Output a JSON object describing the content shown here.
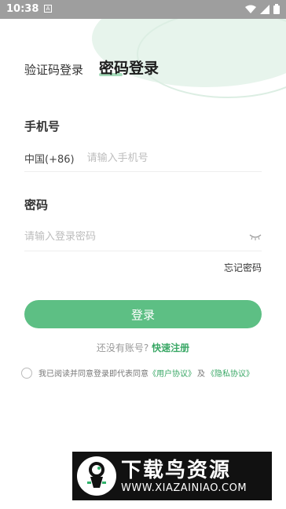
{
  "status_bar": {
    "time": "10:38",
    "notification_glyph": "A",
    "icons": [
      "wifi-icon",
      "signal-icon",
      "battery-icon"
    ]
  },
  "tabs": {
    "sms_login": "验证码登录",
    "password_login": "密码登录"
  },
  "phone": {
    "label": "手机号",
    "country_code": "中国(+86)",
    "placeholder": "请输入手机号",
    "value": ""
  },
  "password": {
    "label": "密码",
    "placeholder": "请输入登录密码",
    "value": "",
    "toggle_icon": "eye-closed-icon"
  },
  "forgot_password": "忘记密码",
  "login_button": "登录",
  "register": {
    "prompt": "还没有账号?",
    "link": "快速注册"
  },
  "agreement": {
    "prefix": "我已阅读并同意登录即代表同意",
    "user_agreement": "《用户协议》",
    "and": "及",
    "privacy_agreement": "《隐私协议》",
    "checked": false
  },
  "watermark": {
    "title": "下载鸟资源",
    "url": "WWW.XIAZAINIAO.COM"
  },
  "colors": {
    "accent": "#5dbf84",
    "link": "#3aa866",
    "status_bar": "#9e9e9e",
    "decor": "#e7f4ec"
  }
}
